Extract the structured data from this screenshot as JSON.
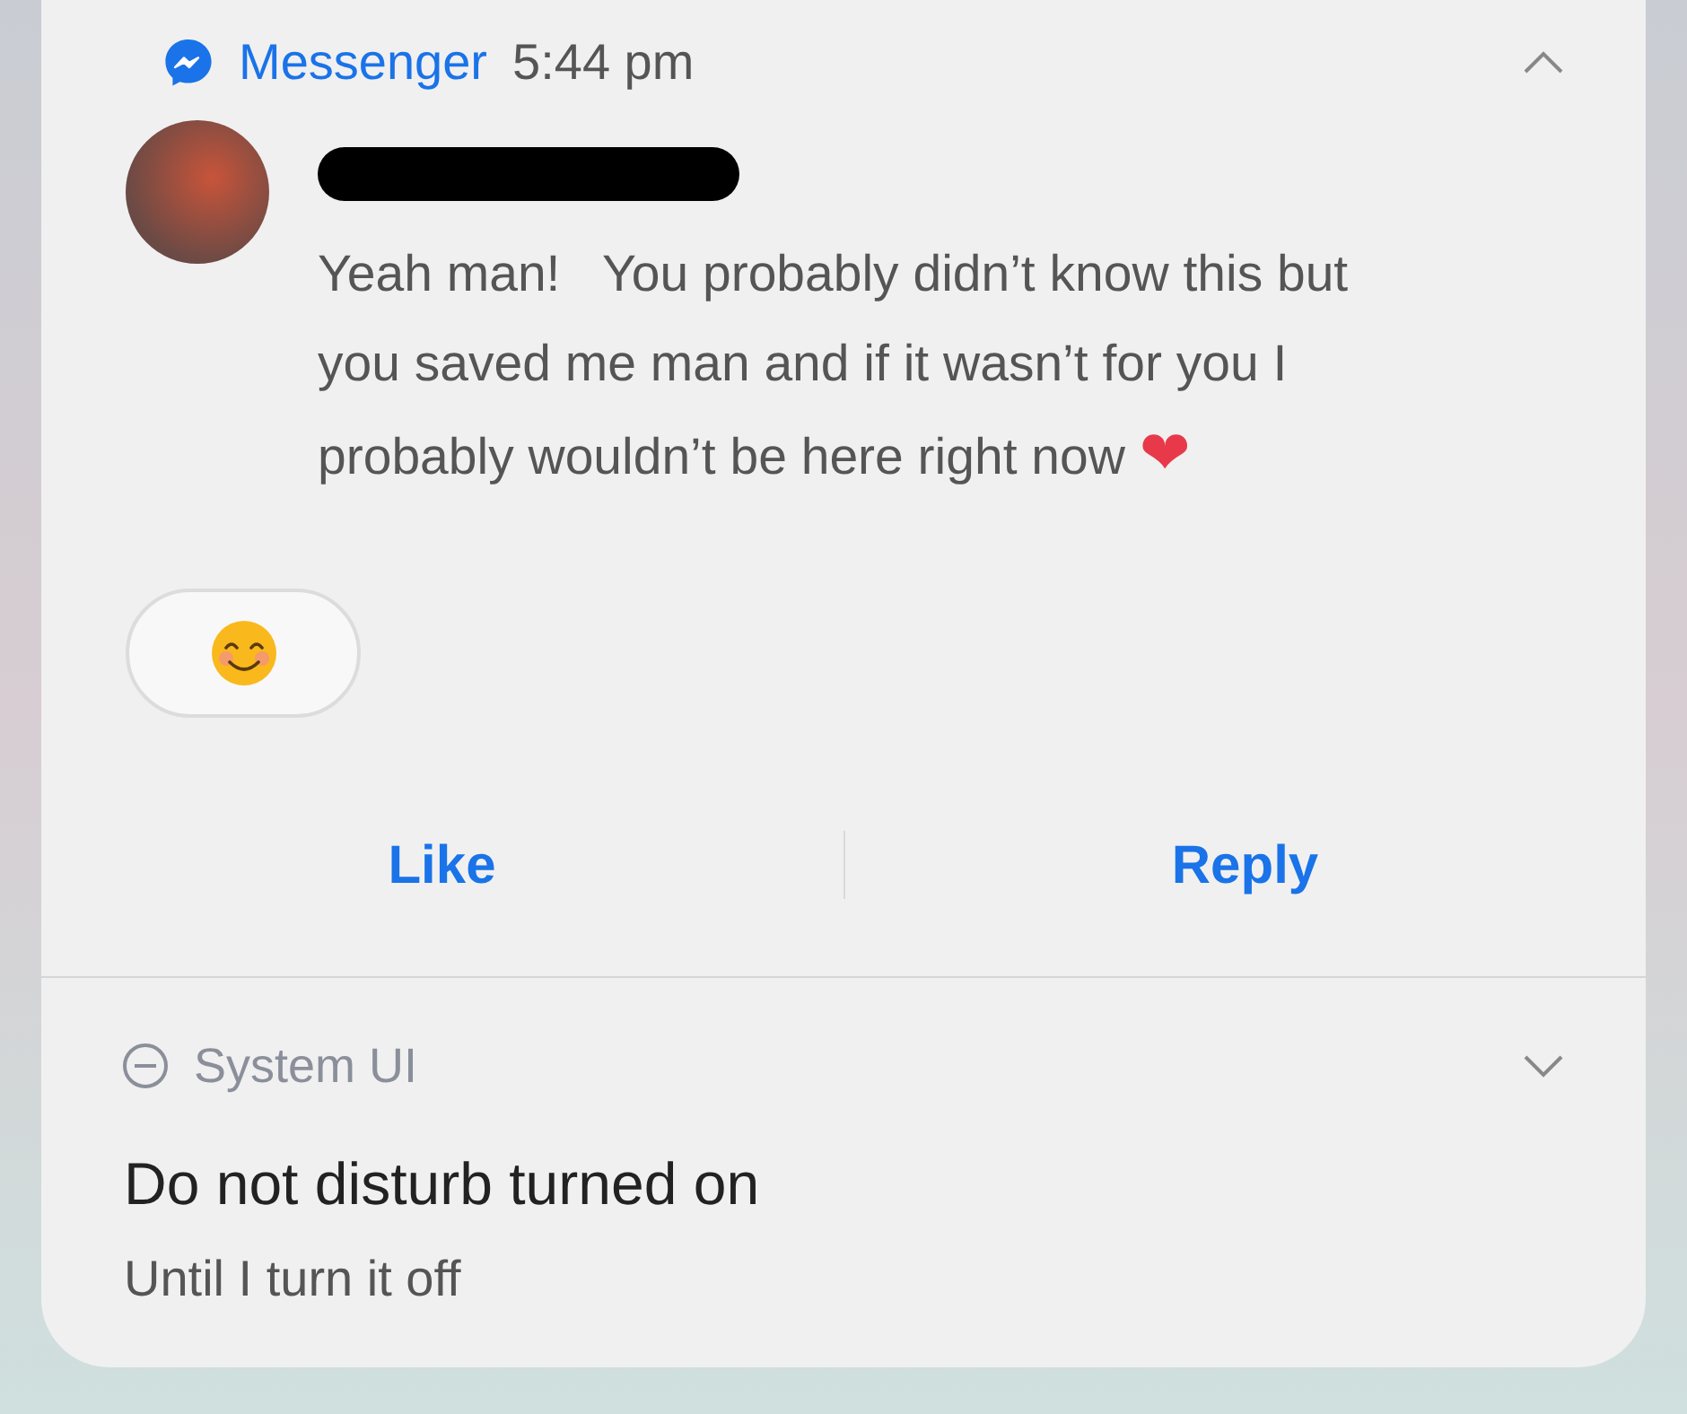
{
  "messenger_notification": {
    "app_name": "Messenger",
    "time": "5:44 pm",
    "expanded": true,
    "message": "Yeah man!   You probably didn’t know this but you saved me man and if it wasn’t for you I probably wouldn’t be here right now",
    "message_emoji": "❤",
    "actions": [
      "Like",
      "Reply"
    ]
  },
  "system_notification": {
    "app_name": "System UI",
    "expanded": false,
    "title": "Do not disturb turned on",
    "subtitle": "Until I turn it off"
  }
}
